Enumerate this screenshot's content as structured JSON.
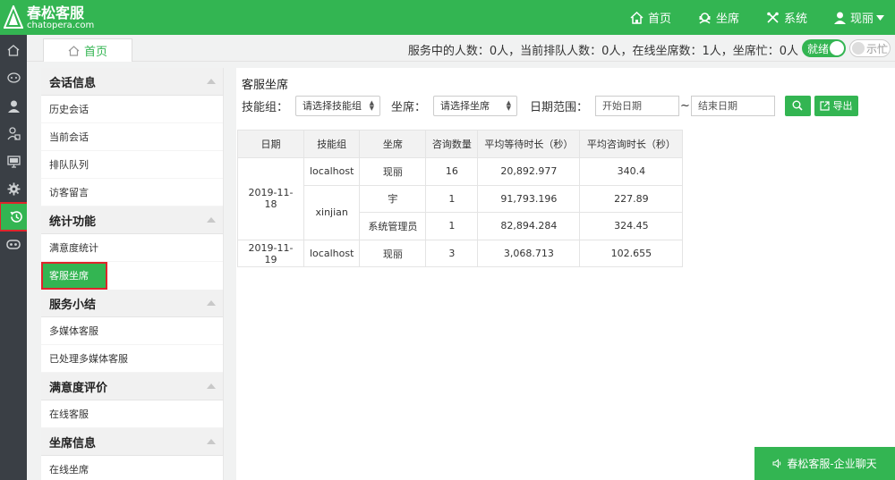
{
  "brand": {
    "title": "春松客服",
    "subtitle": "chatopera.com"
  },
  "topnav": {
    "home": "首页",
    "agent": "坐席",
    "system": "系统",
    "user": "现丽"
  },
  "tab": {
    "home": "首页"
  },
  "status": {
    "text": "服务中的人数：0人，当前排队人数：0人，在线坐席数：1人，坐席忙：0人",
    "ready_label": "就绪",
    "busy_label": "示忙"
  },
  "rail": {
    "icons": [
      "home-icon",
      "chat-bubble-icon",
      "person-icon",
      "contacts-icon",
      "monitor-icon",
      "gear-icon",
      "history-icon",
      "robot-icon"
    ]
  },
  "sidemenu": {
    "sections": [
      {
        "title": "会话信息",
        "items": [
          "历史会话",
          "当前会话",
          "排队队列",
          "访客留言"
        ]
      },
      {
        "title": "统计功能",
        "items": [
          "满意度统计",
          "客服坐席"
        ]
      },
      {
        "title": "服务小结",
        "items": [
          "多媒体客服",
          "已处理多媒体客服"
        ]
      },
      {
        "title": "满意度评价",
        "items": [
          "在线客服"
        ]
      },
      {
        "title": "坐席信息",
        "items": [
          "在线坐席"
        ]
      }
    ]
  },
  "main": {
    "title": "客服坐席",
    "filters": {
      "skill_label": "技能组：",
      "skill_value": "请选择技能组",
      "agent_label": "坐席：",
      "agent_value": "请选择坐席",
      "date_label": "日期范围：",
      "start_placeholder": "开始日期",
      "tilde": "~",
      "end_placeholder": "结束日期",
      "export_label": "导出"
    },
    "table": {
      "headers": [
        "日期",
        "技能组",
        "坐席",
        "咨询数量",
        "平均等待时长（秒）",
        "平均咨询时长（秒）"
      ],
      "rows": [
        {
          "date": "2019-11-18",
          "skill": "localhost",
          "agent": "现丽",
          "count": "16",
          "wait": "20,892.977",
          "consult": "340.4"
        },
        {
          "date": "",
          "skill": "xinjian",
          "agent": "宇",
          "count": "1",
          "wait": "91,793.196",
          "consult": "227.89"
        },
        {
          "date": "",
          "skill": "",
          "agent": "系统管理员",
          "count": "1",
          "wait": "82,894.284",
          "consult": "324.45"
        },
        {
          "date": "2019-11-19",
          "skill": "localhost",
          "agent": "现丽",
          "count": "3",
          "wait": "3,068.713",
          "consult": "102.655"
        }
      ]
    }
  },
  "chat_button": {
    "label": "春松客服-企业聊天"
  },
  "colors": {
    "brand_green": "#33b552",
    "rail_dark": "#3a3f45",
    "highlight_red": "#e0242b"
  }
}
